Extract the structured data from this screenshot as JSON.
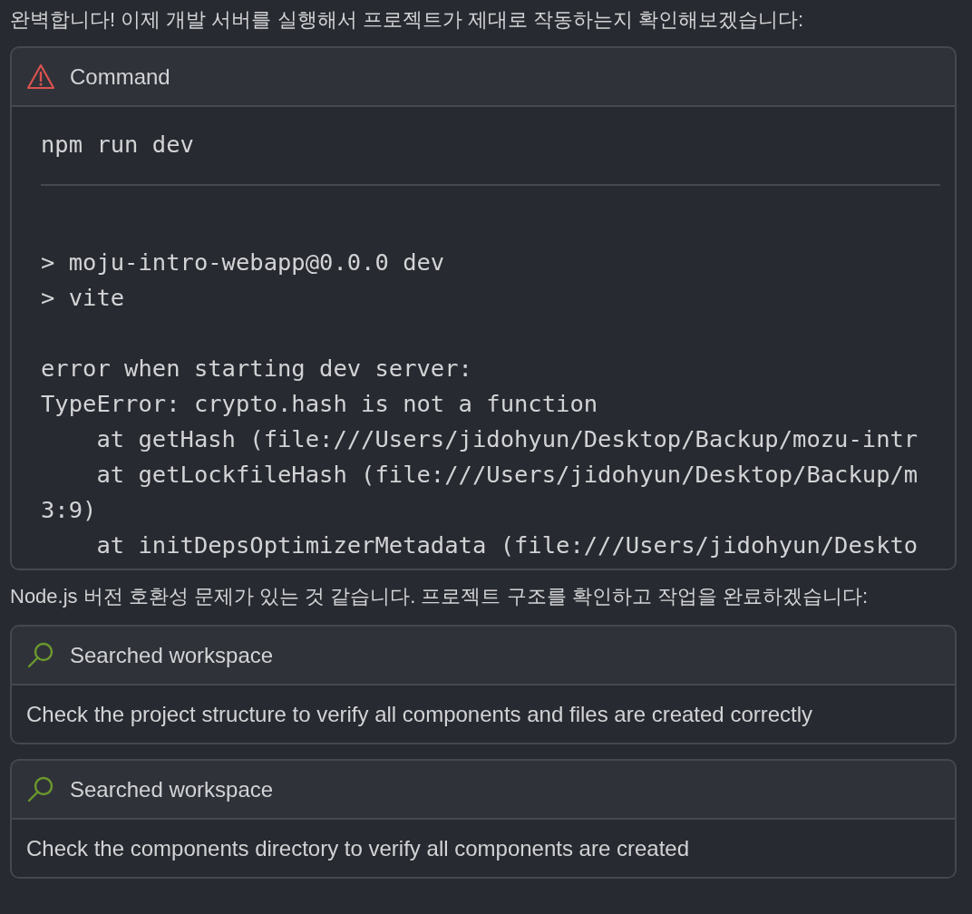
{
  "intro": "완벽합니다! 이제 개발 서버를 실행해서 프로젝트가 제대로 작동하는지 확인해보겠습니다:",
  "command_card": {
    "title": "Command",
    "command": "npm run dev",
    "output_blocks": [
      [
        "> moju-intro-webapp@0.0.0 dev",
        "> vite"
      ],
      [
        "error when starting dev server:",
        "TypeError: crypto.hash is not a function",
        "    at getHash (file:///Users/jidohyun/Desktop/Backup/mozu-intr",
        "    at getLockfileHash (file:///Users/jidohyun/Desktop/Backup/m",
        "3:9)",
        "    at initDepsOptimizerMetadata (file:///Users/jidohyun/Deskto"
      ]
    ]
  },
  "message": "Node.js 버전 호환성 문제가 있는 것 같습니다. 프로젝트 구조를 확인하고 작업을 완료하겠습니다:",
  "search_cards": [
    {
      "title": "Searched workspace",
      "description": "Check the project structure to verify all components and files are created correctly"
    },
    {
      "title": "Searched workspace",
      "description": "Check the components directory to verify all components are created"
    }
  ]
}
